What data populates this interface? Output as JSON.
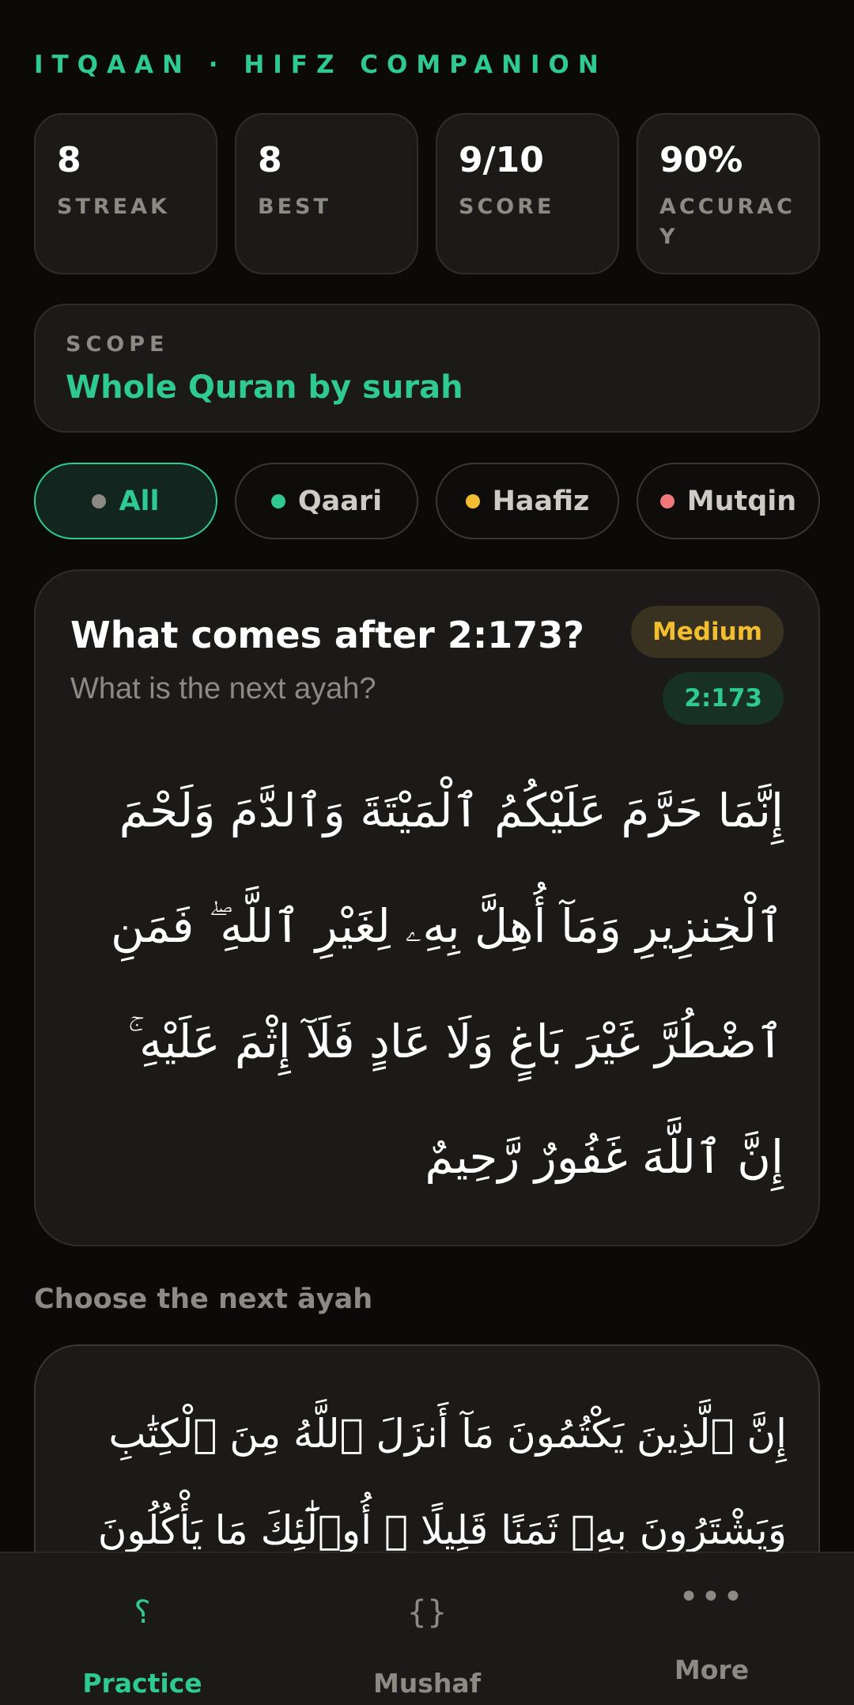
{
  "app": {
    "brand": "ITQAAN · HIFZ COMPANION"
  },
  "stats": [
    {
      "value": "8",
      "label": "STREAK"
    },
    {
      "value": "8",
      "label": "BEST"
    },
    {
      "value": "9/10",
      "label": "SCORE"
    },
    {
      "value": "90%",
      "label": "ACCURACY"
    }
  ],
  "scope": {
    "label": "SCOPE",
    "value": "Whole Quran by surah"
  },
  "filters": [
    {
      "label": "All",
      "dot_color": "#8d8983",
      "active": true
    },
    {
      "label": "Qaari",
      "dot_color": "#2fc993",
      "active": false
    },
    {
      "label": "Haafiz",
      "dot_color": "#f2bd2f",
      "active": false
    },
    {
      "label": "Mutqin",
      "dot_color": "#f07878",
      "active": false
    }
  ],
  "question": {
    "title": "What comes after 2:173?",
    "subtitle": "What is the next ayah?",
    "difficulty": "Medium",
    "reference": "2:173",
    "ayah_text": "إِنَّمَا حَرَّمَ عَلَيْكُمُ ٱلْمَيْتَةَ وَٱلدَّمَ وَلَحْمَ ٱلْخِنزِيرِ وَمَآ أُهِلَّ بِهِۦ لِغَيْرِ ٱللَّهِ ۖ فَمَنِ ٱضْطُرَّ غَيْرَ بَاغٍ وَلَا عَادٍ فَلَآ إِثْمَ عَلَيْهِ ۚ إِنَّ ٱللَّهَ غَفُورٌ رَّحِيمٌ"
  },
  "choices": {
    "heading": "Choose the next āyah",
    "options": [
      {
        "text": "إِنَّ ٱلَّذِينَ يَكْتُمُونَ مَآ أَنزَلَ ٱللَّهُ مِنَ ٱلْكِتَٰبِ وَيَشْتَرُونَ بِهِۦ ثَمَنًا قَلِيلًا ۙ أُو۟لَٰٓئِكَ مَا يَأْكُلُونَ"
      }
    ]
  },
  "tabs": [
    {
      "label": "Practice",
      "icon": "question-mark-icon",
      "glyph": "؟",
      "active": true
    },
    {
      "label": "Mushaf",
      "icon": "braces-book-icon",
      "glyph": "{}",
      "active": false
    },
    {
      "label": "More",
      "icon": "more-dots-icon",
      "glyph": "•••",
      "active": false
    }
  ],
  "colors": {
    "accent": "#2fc993",
    "medium": "#f2bd2f",
    "mutqin": "#f07878",
    "background": "#0b0a09",
    "card": "#1c1a18"
  }
}
